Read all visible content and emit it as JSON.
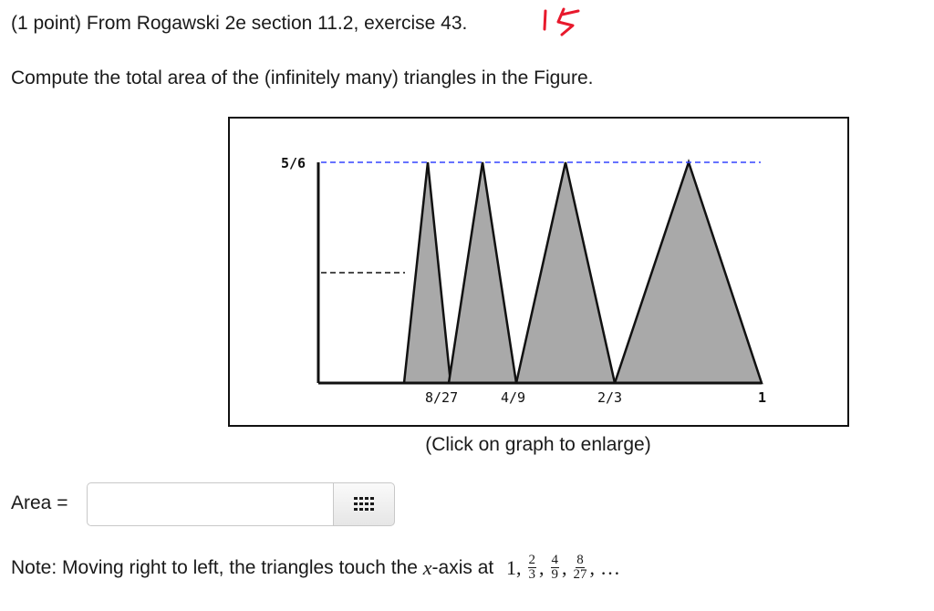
{
  "header": {
    "text": "(1 point) From Rogawski 2e section 11.2, exercise 43.",
    "handwritten_note": "15"
  },
  "question": "Compute the total area of the (infinitely many) triangles in the Figure.",
  "figure": {
    "y_label": "5/6",
    "x_labels": [
      "8/27",
      "4/9",
      "2/3",
      "1"
    ],
    "caption": "(Click on graph to enlarge)",
    "colors": {
      "fill": "#a9a9a9",
      "dash_top": "#3344ff",
      "dash_mid": "#111111"
    }
  },
  "answer": {
    "label": "Area =",
    "input_value": "",
    "palette_icon": "grid-icon"
  },
  "note": {
    "prefix": "Note: Moving right to left, the triangles touch the ",
    "var": "x",
    "suffix": "-axis at ",
    "first": "1,",
    "fractions": [
      {
        "num": "2",
        "den": "3"
      },
      {
        "num": "4",
        "den": "9"
      },
      {
        "num": "8",
        "den": "27"
      }
    ],
    "ellipsis": "…"
  }
}
